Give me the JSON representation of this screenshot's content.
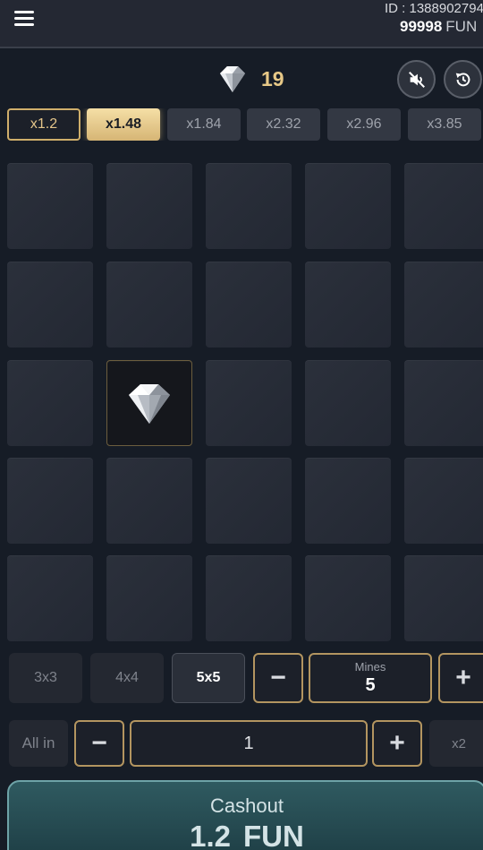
{
  "header": {
    "menu_icon": "hamburger-menu-icon",
    "user_id": "ID : 1388902794",
    "balance_amount": "99998",
    "balance_currency": "FUN"
  },
  "status": {
    "gem_icon": "diamond-icon",
    "gems_remaining": "19",
    "sound_icon": "sound-muted-icon",
    "history_icon": "history-icon"
  },
  "multipliers": [
    {
      "label": "x1.2",
      "state": "done"
    },
    {
      "label": "x1.48",
      "state": "active"
    },
    {
      "label": "x1.84",
      "state": "upcoming"
    },
    {
      "label": "x2.32",
      "state": "upcoming"
    },
    {
      "label": "x2.96",
      "state": "upcoming"
    },
    {
      "label": "x3.85",
      "state": "upcoming"
    }
  ],
  "grid": {
    "rows": 5,
    "cols": 5,
    "revealed": [
      {
        "row": 2,
        "col": 1,
        "content": "diamond"
      }
    ]
  },
  "board_size": {
    "options": [
      "3x3",
      "4x4",
      "5x5"
    ],
    "selected": "5x5"
  },
  "mines": {
    "minus_label": "−",
    "label": "Mines",
    "value": "5",
    "plus_label": "+"
  },
  "bet": {
    "all_in_label": "All in",
    "minus_label": "−",
    "value": "1",
    "plus_label": "+",
    "double_label": "x2"
  },
  "cashout": {
    "label": "Cashout",
    "amount": "1.2",
    "currency": "FUN"
  },
  "colors": {
    "background": "#161c26",
    "accent_gold": "#e7c887",
    "cashout_teal": "#2f5a60"
  }
}
